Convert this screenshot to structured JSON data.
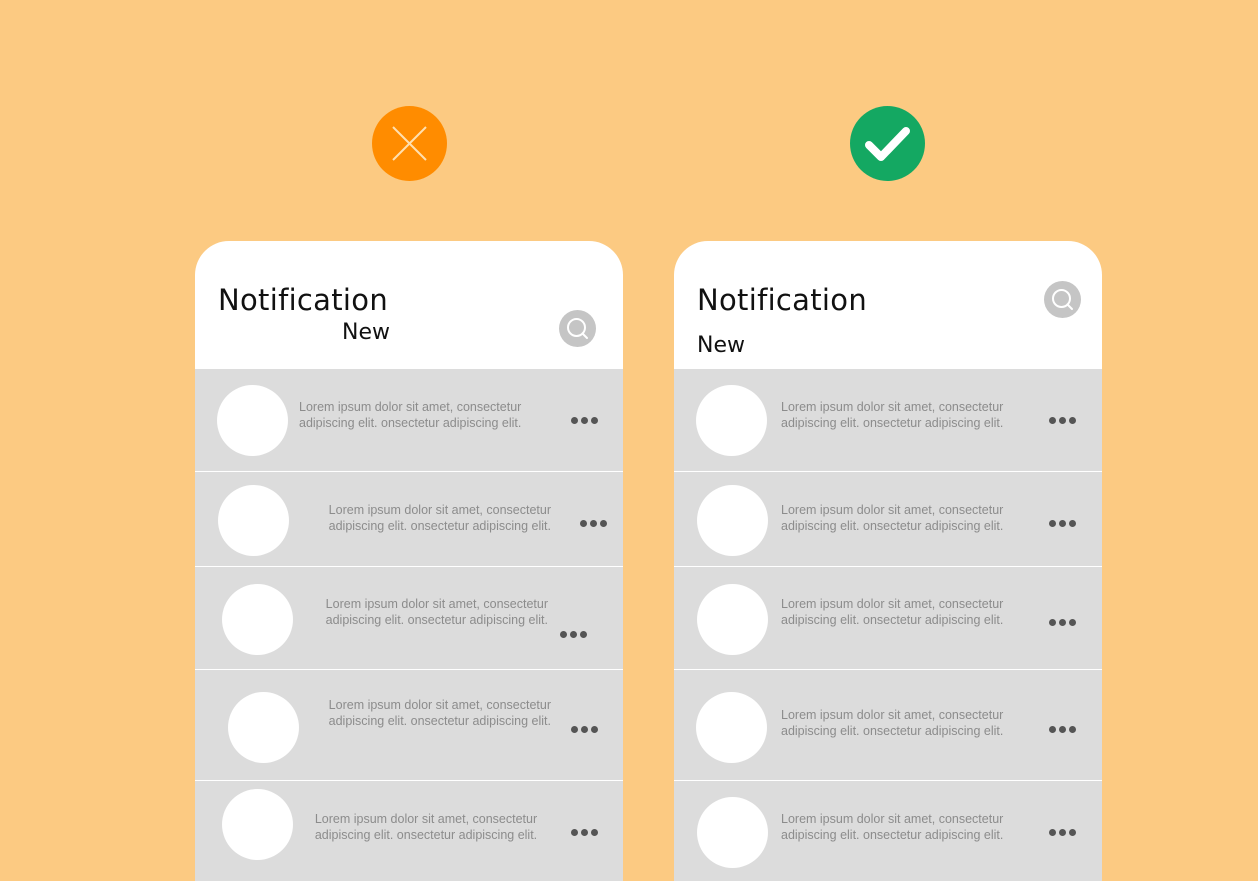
{
  "bad_example": {
    "title": "Notification",
    "subtitle": "New",
    "items": [
      {
        "text": "Lorem ipsum dolor sit amet, consectetur adipiscing elit. onsectetur adipiscing elit."
      },
      {
        "text": "Lorem ipsum dolor sit amet, consectetur adipiscing elit. onsectetur adipiscing elit."
      },
      {
        "text": "Lorem ipsum dolor sit amet, consectetur adipiscing elit. onsectetur adipiscing elit."
      },
      {
        "text": "Lorem ipsum dolor sit amet, consectetur adipiscing elit. onsectetur adipiscing elit."
      },
      {
        "text": "Lorem ipsum dolor sit amet, consectetur adipiscing elit. onsectetur adipiscing elit."
      }
    ]
  },
  "good_example": {
    "title": "Notification",
    "subtitle": "New",
    "items": [
      {
        "text": "Lorem ipsum dolor sit amet, consectetur adipiscing elit. onsectetur adipiscing elit."
      },
      {
        "text": "Lorem ipsum dolor sit amet, consectetur adipiscing elit. onsectetur adipiscing elit."
      },
      {
        "text": "Lorem ipsum dolor sit amet, consectetur adipiscing elit. onsectetur adipiscing elit."
      },
      {
        "text": "Lorem ipsum dolor sit amet, consectetur adipiscing elit. onsectetur adipiscing elit."
      },
      {
        "text": "Lorem ipsum dolor sit amet, consectetur adipiscing elit. onsectetur adipiscing elit."
      }
    ]
  },
  "icons": {
    "bad": "cross-icon",
    "good": "check-icon",
    "search": "search-icon",
    "more": "more-dots-icon"
  },
  "colors": {
    "background": "#FCCA82",
    "bad_accent": "#FF8C00",
    "good_accent": "#14A862",
    "list_bg": "#DCDCDC",
    "search_bg": "#C5C5C5"
  }
}
